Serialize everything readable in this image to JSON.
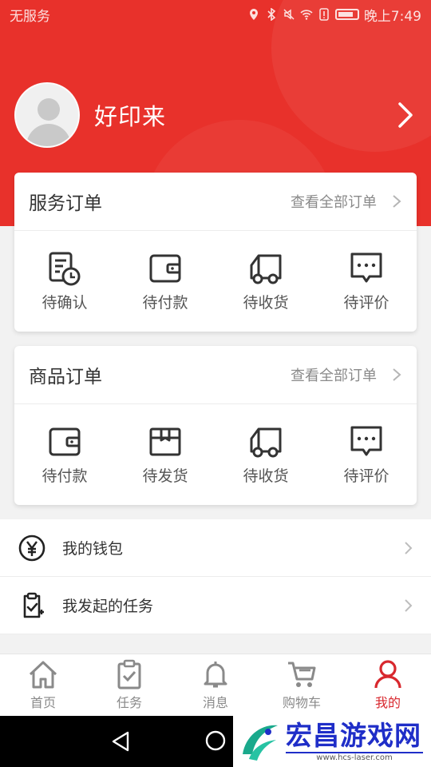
{
  "status_bar": {
    "carrier": "无服务",
    "time": "晚上7:49"
  },
  "profile": {
    "username": "好印来"
  },
  "service_orders": {
    "title": "服务订单",
    "view_all": "查看全部订单",
    "items": [
      {
        "label": "待确认",
        "icon": "pending-confirm-icon"
      },
      {
        "label": "待付款",
        "icon": "wallet-icon"
      },
      {
        "label": "待收货",
        "icon": "truck-icon"
      },
      {
        "label": "待评价",
        "icon": "comment-icon"
      }
    ]
  },
  "goods_orders": {
    "title": "商品订单",
    "view_all": "查看全部订单",
    "items": [
      {
        "label": "待付款",
        "icon": "wallet-icon"
      },
      {
        "label": "待发货",
        "icon": "package-icon"
      },
      {
        "label": "待收货",
        "icon": "truck-icon"
      },
      {
        "label": "待评价",
        "icon": "comment-icon"
      }
    ]
  },
  "menu": [
    {
      "label": "我的钱包",
      "icon": "yuan-icon"
    },
    {
      "label": "我发起的任务",
      "icon": "clipboard-check-icon"
    }
  ],
  "tabbar": [
    {
      "label": "首页",
      "icon": "home-icon"
    },
    {
      "label": "任务",
      "icon": "task-icon"
    },
    {
      "label": "消息",
      "icon": "bell-icon"
    },
    {
      "label": "购物车",
      "icon": "cart-icon"
    },
    {
      "label": "我的",
      "icon": "user-icon",
      "active": true
    }
  ],
  "watermark": {
    "title": "宏昌游戏网",
    "url": "www.hcs-laser.com"
  },
  "colors": {
    "brand_red": "#e8312b",
    "tab_active": "#d8282e",
    "watermark_blue": "#1f2ec8"
  }
}
